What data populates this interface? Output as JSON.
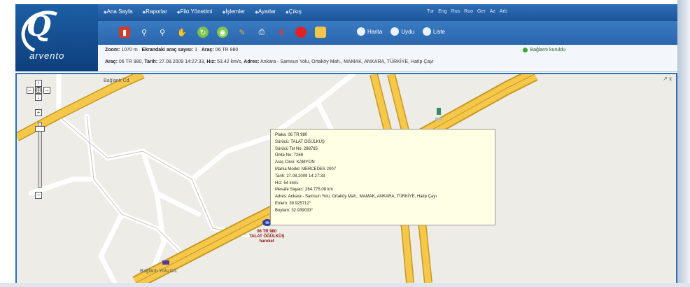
{
  "app": {
    "logo_text": "arvento"
  },
  "nav": {
    "items": [
      "Ana Sayfa",
      "Raporlar",
      "Filo Yönetimi",
      "İşlemler",
      "Ayarlar",
      "Çıkış"
    ],
    "languages": [
      "Tur",
      "Eng",
      "Rus",
      "Ruo",
      "Ger",
      "Az",
      "Arb"
    ]
  },
  "toolbar": {
    "tools": [
      {
        "icon": "car-list-icon",
        "color": "#d23b2b"
      },
      {
        "icon": "pin-icon",
        "color": "#ffffff"
      },
      {
        "icon": "pin-icon",
        "color": "#ffffff"
      },
      {
        "icon": "hand-icon",
        "color": "#ffffff"
      },
      {
        "icon": "refresh-icon",
        "color": "#79c24a"
      },
      {
        "icon": "target-icon",
        "color": "#7fc84f"
      },
      {
        "icon": "pencil-icon",
        "color": "#f0a830"
      },
      {
        "icon": "print-icon",
        "color": "#ffffff"
      },
      {
        "icon": "bug-icon",
        "color": "#c94040"
      },
      {
        "icon": "stop-icon",
        "color": "#e12222"
      },
      {
        "icon": "folder-icon",
        "color": "#f3c64a"
      }
    ],
    "views": [
      "Harita",
      "Uydu",
      "Liste"
    ]
  },
  "info": {
    "zoom_label": "Zoom:",
    "zoom_value": "1070 m",
    "count_label": "Ekrandaki araç sayısı:",
    "count_value": "1",
    "vehicle_label": "Araç:",
    "vehicle_value": "06 TR 980",
    "connection": "Bağlantı kuruldu",
    "row2_vehicle_label": "Araç:",
    "row2_vehicle_value": "06 TR 980,",
    "date_label": "Tarih:",
    "date_value": "27.08.2009 14:27:33,",
    "speed_label": "Hız:",
    "speed_value": "53.42 km/s,",
    "address_label": "Adres:",
    "address_value": "Ankara - Samsun Yolu, Ortaköy Mah., MAMAK, ANKARA, TÜRKİYE, Hatip Çayı"
  },
  "map": {
    "close": "↗ x",
    "street_label": "Bağlantı Cd.",
    "place_label": "Bağlantı Yolu Cd."
  },
  "popup": {
    "lines": [
      "Plaka: 06 TR 980",
      "Sürücü: TALAT ÖĞÜLKÜŞ",
      "Sürücü Tel No: 288765",
      "Ünite No: 7268",
      "Araç Cinsi: KAMYON",
      "Marka Model: MERCEDES 2007",
      "Tarih: 27.08.2009 14:27:33",
      "Hız: 54 km/s",
      "Mesafe Sayacı: 264.775,08 km",
      "Adres: Ankara - Samsun Yolu, Ortaköy Mah., MAMAK, ANKARA, TÜRKİYE, Hatip Çayı",
      "Enlem: 39.925712°",
      "Boylam: 32.939033°"
    ]
  },
  "vehicle": {
    "plate": "06 TR 980",
    "driver": "TALAT ÖĞÜLKÜŞ",
    "status": "hareket"
  }
}
